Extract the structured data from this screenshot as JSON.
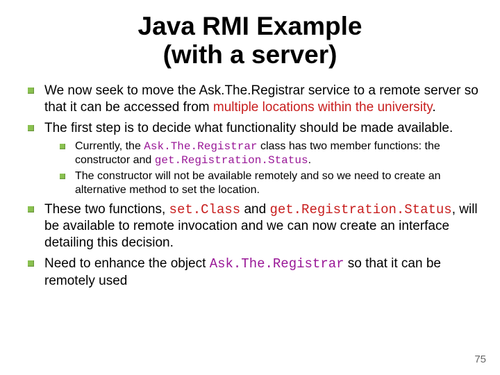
{
  "title_line1": "Java RMI Example",
  "title_line2": "(with a server)",
  "bullets": {
    "b1_a": "We now seek to move the Ask.The.Registrar service to a remote server so that it can be accessed from ",
    "b1_hl": "multiple locations within the university",
    "b1_c": ".",
    "b2": "The first step is to decide what functionality should be made available.",
    "b2_1_a": "Currently, the ",
    "b2_1_code1": "Ask.The.Registrar",
    "b2_1_b": " class has two member functions: the constructor and ",
    "b2_1_code2": "get.Registration.Status",
    "b2_1_c": ".",
    "b2_2": "The constructor will not be available remotely and so we need to create an alternative method to set the location.",
    "b3_a": "These two functions, ",
    "b3_code1": "set.Class",
    "b3_b": " and ",
    "b3_code2": "get.Registration.Status",
    "b3_c": ", will be available to remote invocation and we can now create an interface detailing this decision.",
    "b4_a": "Need to enhance the object ",
    "b4_code": "Ask.The.Registrar",
    "b4_b": " so that it can be remotely used"
  },
  "page_number": "75"
}
